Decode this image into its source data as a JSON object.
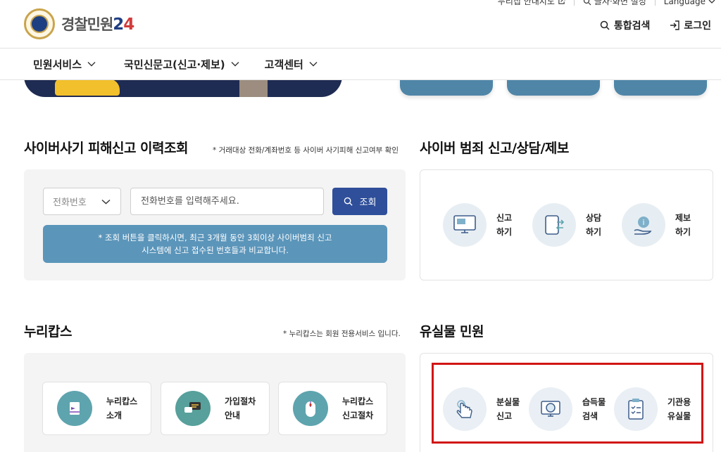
{
  "header": {
    "logo_text": "경찰민원",
    "logo_num": "2",
    "logo_num_accent": "4",
    "util": {
      "sitemap": "누리집 안내지도",
      "display_settings": "글자·화면 설정",
      "language": "Language"
    },
    "search_label": "통합검색",
    "login_label": "로그인"
  },
  "nav": {
    "items": [
      {
        "label": "민원서비스"
      },
      {
        "label": "국민신문고(신고·제보)"
      },
      {
        "label": "고객센터"
      }
    ]
  },
  "cyber_fraud": {
    "title": "사이버사기 피해신고 이력조회",
    "note": "* 거래대상 전화/계좌번호 등 사이버 사기피해 신고여부 확인",
    "select_value": "전화번호",
    "input_placeholder": "전화번호를 입력해주세요.",
    "search_button": "조회",
    "notice_line1": "* 조회 버튼을 클릭하시면, 최근 3개월 동안 3회이상 사이버범죄 신고",
    "notice_line2": "시스템에 신고 접수된 번호들과 비교합니다."
  },
  "cyber_crime": {
    "title": "사이버 범죄 신고/상담/제보",
    "items": [
      {
        "line1": "신고",
        "line2": "하기"
      },
      {
        "line1": "상담",
        "line2": "하기"
      },
      {
        "line1": "제보",
        "line2": "하기"
      }
    ]
  },
  "nurikaps": {
    "title": "누리캅스",
    "note": "* 누리캅스는 회원 전용서비스 입니다.",
    "cards": [
      {
        "line1": "누리캅스",
        "line2": "소개"
      },
      {
        "line1": "가입절차",
        "line2": "안내"
      },
      {
        "line1": "누리캅스",
        "line2": "신고절차"
      }
    ]
  },
  "lost_items": {
    "title": "유실물 민원",
    "items": [
      {
        "line1": "분실물",
        "line2": "신고"
      },
      {
        "line1": "습득물",
        "line2": "검색"
      },
      {
        "line1": "기관용",
        "line2": "유실물"
      }
    ]
  },
  "colors": {
    "brand_navy": "#2f4f9a",
    "notice_blue": "#5b95ba",
    "highlight_red": "#d21414"
  }
}
